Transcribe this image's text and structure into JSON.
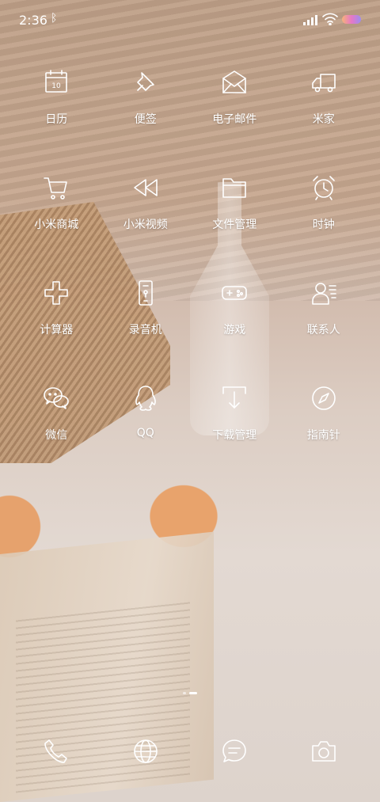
{
  "status_bar": {
    "time": "2:36",
    "bluetooth": "ᛒ"
  },
  "apps": [
    {
      "label": "日历",
      "icon": "calendar-icon",
      "day": "10"
    },
    {
      "label": "便签",
      "icon": "pin-note-icon"
    },
    {
      "label": "电子邮件",
      "icon": "mail-icon"
    },
    {
      "label": "米家",
      "icon": "truck-icon"
    },
    {
      "label": "小米商城",
      "icon": "cart-icon"
    },
    {
      "label": "小米视频",
      "icon": "rewind-icon"
    },
    {
      "label": "文件管理",
      "icon": "folder-icon"
    },
    {
      "label": "时钟",
      "icon": "alarm-clock-icon"
    },
    {
      "label": "计算器",
      "icon": "plus-icon"
    },
    {
      "label": "录音机",
      "icon": "phone-recorder-icon"
    },
    {
      "label": "游戏",
      "icon": "gamepad-icon"
    },
    {
      "label": "联系人",
      "icon": "contacts-icon"
    },
    {
      "label": "微信",
      "icon": "wechat-icon"
    },
    {
      "label": "QQ",
      "icon": "penguin-icon"
    },
    {
      "label": "下载管理",
      "icon": "download-icon"
    },
    {
      "label": "指南针",
      "icon": "compass-icon"
    }
  ],
  "dock": [
    {
      "icon": "phone-icon"
    },
    {
      "icon": "globe-icon"
    },
    {
      "icon": "message-icon"
    },
    {
      "icon": "camera-icon"
    }
  ],
  "pager": {
    "pages": 2,
    "active": 2
  }
}
